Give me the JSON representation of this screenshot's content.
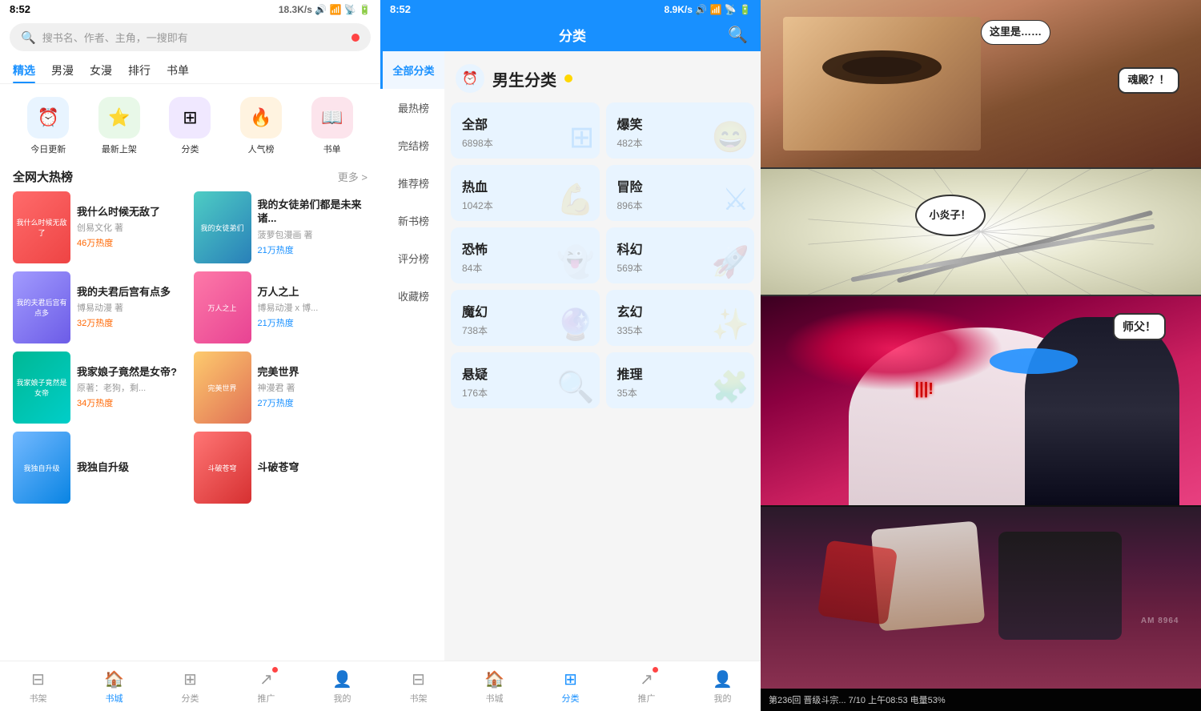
{
  "panel_left": {
    "status_time": "8:52",
    "status_network": "18.3K/s",
    "search_placeholder": "搜书名、作者、主角，一搜即有",
    "nav_tabs": [
      "精选",
      "男漫",
      "女漫",
      "排行",
      "书单"
    ],
    "active_tab": "精选",
    "icons": [
      {
        "id": "today-update",
        "label": "今日更新",
        "symbol": "⏰",
        "color": "#5b9bd5"
      },
      {
        "id": "new-shelf",
        "label": "最新上架",
        "symbol": "⭐",
        "color": "#5bb85d"
      },
      {
        "id": "category",
        "label": "分类",
        "symbol": "⊞",
        "color": "#7c4dff"
      },
      {
        "id": "popular",
        "label": "人气榜",
        "symbol": "🔥",
        "color": "#ff9800"
      },
      {
        "id": "booklist",
        "label": "书单",
        "symbol": "📖",
        "color": "#e91e63"
      }
    ],
    "section_title": "全网大热榜",
    "section_more": "更多 >",
    "books": [
      {
        "title": "我什么时候无敌了",
        "author": "创易文化 著",
        "heat": "46万热度",
        "heat_color": "orange"
      },
      {
        "title": "我的女徒弟们都是未来诸...",
        "author": "菠萝包漫画 著",
        "heat": "21万热度",
        "heat_color": "blue"
      },
      {
        "title": "我的夫君后宫有点多",
        "author": "博易动漫 著",
        "heat": "32万热度",
        "heat_color": "orange"
      },
      {
        "title": "万人之上",
        "author": "博易动漫 x 博...",
        "heat": "21万热度",
        "heat_color": "blue"
      },
      {
        "title": "我家娘子竟然是女帝?",
        "author": "原著：老狗，剩...",
        "heat": "34万热度",
        "heat_color": "orange"
      },
      {
        "title": "完美世界",
        "author": "神漫君 著",
        "heat": "27万热度",
        "heat_color": "blue"
      },
      {
        "title": "我独自升级",
        "author": "",
        "heat": "",
        "heat_color": "orange"
      },
      {
        "title": "斗破苍穹",
        "author": "",
        "heat": "",
        "heat_color": "blue"
      }
    ],
    "bottom_nav": [
      {
        "label": "书架",
        "symbol": "⊟",
        "active": false,
        "badge": false
      },
      {
        "label": "书城",
        "symbol": "🏠",
        "active": true,
        "badge": false
      },
      {
        "label": "分类",
        "symbol": "⊞",
        "active": false,
        "badge": false
      },
      {
        "label": "推广",
        "symbol": "↗",
        "active": false,
        "badge": true
      },
      {
        "label": "我的",
        "symbol": "👤",
        "active": false,
        "badge": false
      }
    ]
  },
  "panel_mid": {
    "status_time": "8:52",
    "status_network": "8.9K/s",
    "header_title": "分类",
    "sidebar_cats": [
      {
        "label": "全部分类",
        "active": true
      },
      {
        "label": "最热榜",
        "active": false
      },
      {
        "label": "完结榜",
        "active": false
      },
      {
        "label": "推荐榜",
        "active": false
      },
      {
        "label": "新书榜",
        "active": false
      },
      {
        "label": "评分榜",
        "active": false
      },
      {
        "label": "收藏榜",
        "active": false
      }
    ],
    "section_title": "男生分类",
    "categories": [
      {
        "name": "全部",
        "count": "6898本"
      },
      {
        "name": "爆笑",
        "count": "482本"
      },
      {
        "name": "热血",
        "count": "1042本"
      },
      {
        "name": "冒险",
        "count": "896本"
      },
      {
        "name": "恐怖",
        "count": "84本"
      },
      {
        "name": "科幻",
        "count": "569本"
      },
      {
        "name": "魔幻",
        "count": "738本"
      },
      {
        "name": "玄幻",
        "count": "335本"
      },
      {
        "name": "悬疑",
        "count": "176本"
      },
      {
        "name": "推理",
        "count": "35本"
      }
    ],
    "bottom_nav": [
      {
        "label": "书架",
        "symbol": "⊟",
        "active": false,
        "badge": false
      },
      {
        "label": "书城",
        "symbol": "🏠",
        "active": false,
        "badge": false
      },
      {
        "label": "分类",
        "symbol": "⊞",
        "active": true,
        "badge": false
      },
      {
        "label": "推广",
        "symbol": "↗",
        "active": false,
        "badge": true
      },
      {
        "label": "我的",
        "symbol": "👤",
        "active": false,
        "badge": false
      }
    ]
  },
  "panel_right": {
    "manga_panels": [
      {
        "dialog1": "这里是……",
        "dialog2": "魂殿？！",
        "bg": "mp1"
      },
      {
        "dialog1": "小炎子！",
        "bg": "mp2"
      },
      {
        "dialog1": "师父！",
        "bg": "mp3"
      },
      {
        "bg": "mp4"
      }
    ],
    "bottom_text": "第236回 晋级斗宗... 7/10 上午08:53 电量53%",
    "watermark": "AM 8964"
  }
}
